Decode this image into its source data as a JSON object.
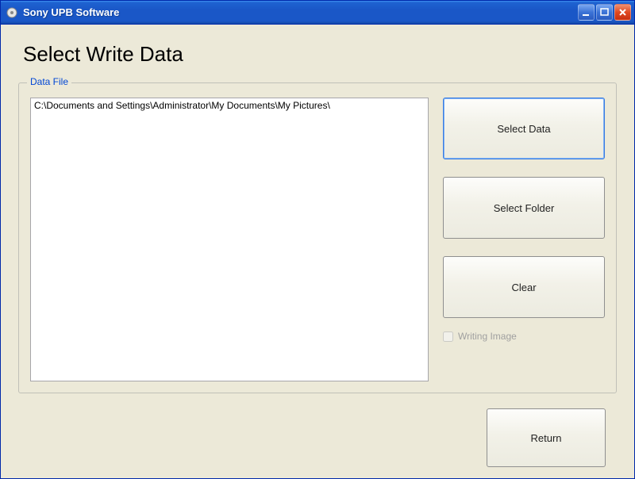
{
  "window": {
    "title": "Sony UPB Software"
  },
  "page": {
    "heading": "Select Write Data",
    "groupLabel": "Data File"
  },
  "fileList": {
    "items": [
      "C:\\Documents and Settings\\Administrator\\My Documents\\My Pictures\\"
    ]
  },
  "buttons": {
    "selectData": "Select Data",
    "selectFolder": "Select Folder",
    "clear": "Clear",
    "return": "Return"
  },
  "checkbox": {
    "writingImage": {
      "label": "Writing Image",
      "checked": false
    }
  }
}
